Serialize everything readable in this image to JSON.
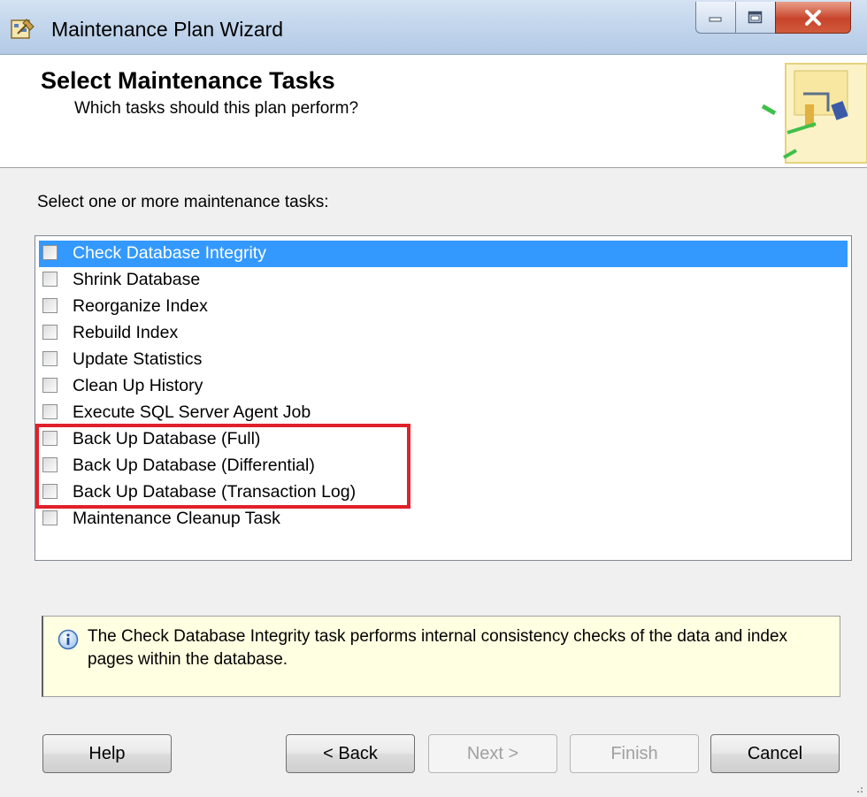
{
  "window": {
    "title": "Maintenance Plan Wizard",
    "app_icon": "maintenance-plan-icon"
  },
  "header": {
    "title": "Select Maintenance Tasks",
    "subtitle": "Which tasks should this plan perform?",
    "graphic": "wizard-flow-graphic"
  },
  "body": {
    "prompt": "Select one or more maintenance tasks:",
    "tasks": [
      {
        "label": "Check Database Integrity",
        "checked": false,
        "selected": true
      },
      {
        "label": "Shrink Database",
        "checked": false,
        "selected": false
      },
      {
        "label": "Reorganize Index",
        "checked": false,
        "selected": false
      },
      {
        "label": "Rebuild Index",
        "checked": false,
        "selected": false
      },
      {
        "label": "Update Statistics",
        "checked": false,
        "selected": false
      },
      {
        "label": "Clean Up History",
        "checked": false,
        "selected": false
      },
      {
        "label": "Execute SQL Server Agent Job",
        "checked": false,
        "selected": false
      },
      {
        "label": "Back Up Database (Full)",
        "checked": false,
        "selected": false
      },
      {
        "label": "Back Up Database (Differential)",
        "checked": false,
        "selected": false
      },
      {
        "label": "Back Up Database (Transaction Log)",
        "checked": false,
        "selected": false
      },
      {
        "label": "Maintenance Cleanup Task",
        "checked": false,
        "selected": false
      }
    ]
  },
  "description": {
    "icon": "info-icon",
    "text": "The Check Database Integrity task performs internal consistency checks of the data and index pages within the database."
  },
  "buttons": {
    "help": "Help",
    "back": "< Back",
    "next": "Next >",
    "finish": "Finish",
    "cancel": "Cancel"
  },
  "colors": {
    "selection": "#3399ff",
    "highlight": "#e0202a",
    "description_bg": "#ffffe1"
  }
}
